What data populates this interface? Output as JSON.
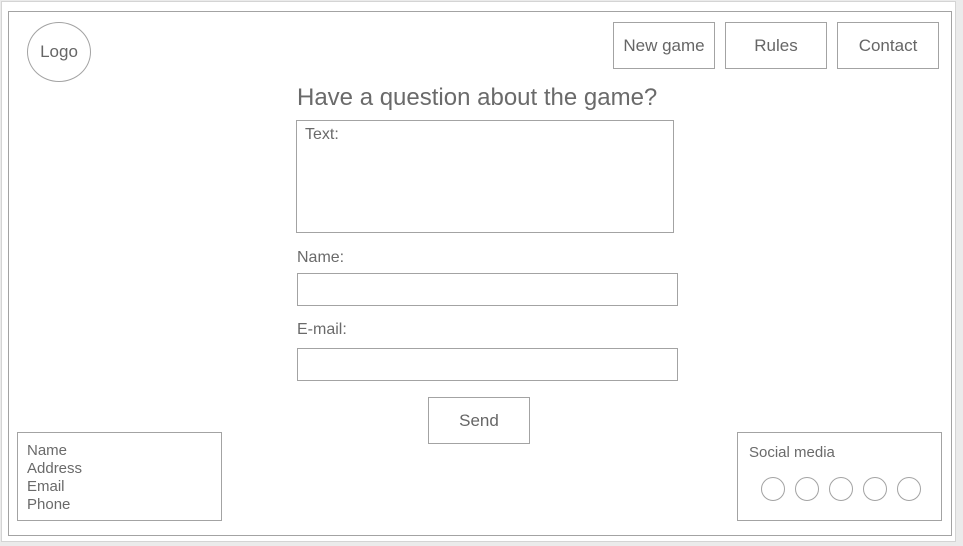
{
  "header": {
    "logo_label": "Logo",
    "nav": [
      {
        "label": "New game"
      },
      {
        "label": "Rules"
      },
      {
        "label": "Contact"
      }
    ]
  },
  "form": {
    "title": "Have a question about the game?",
    "text_placeholder": "Text:",
    "name_label": "Name:",
    "name_value": "",
    "email_label": "E-mail:",
    "email_value": "",
    "send_label": "Send"
  },
  "footer": {
    "contact_lines": [
      "Name",
      "Address",
      "Email",
      "Phone"
    ],
    "social_title": "Social media",
    "social_icons": [
      "social-icon-1",
      "social-icon-2",
      "social-icon-3",
      "social-icon-4",
      "social-icon-5"
    ]
  },
  "colors": {
    "border": "#a3a3a3",
    "text": "#6a6a6a",
    "background": "#ffffff"
  }
}
